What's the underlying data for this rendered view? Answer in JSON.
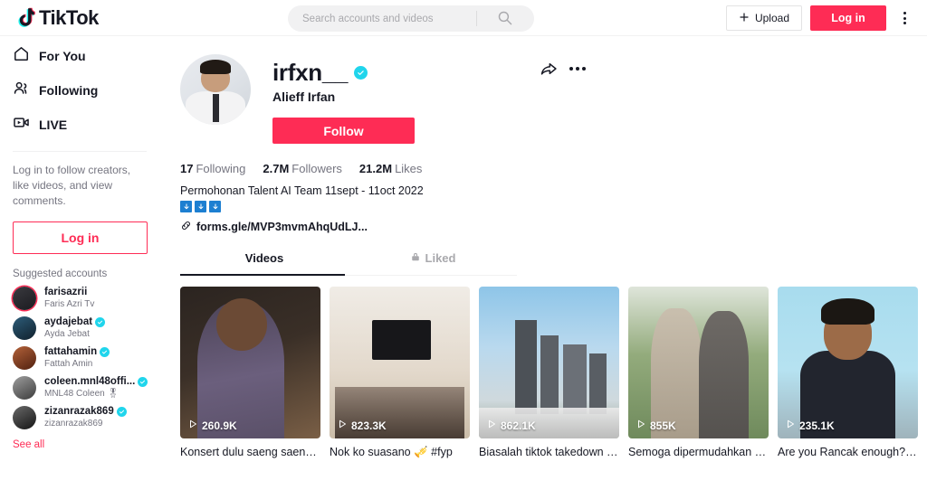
{
  "header": {
    "brand": "TikTok",
    "search": {
      "placeholder": "Search accounts and videos",
      "value": "",
      "icon": "search-icon"
    },
    "upload_label": "Upload",
    "login_label": "Log in",
    "more_icon": "kebab-vertical-icon"
  },
  "sidebar": {
    "nav": [
      {
        "label": "For You",
        "icon": "home-icon"
      },
      {
        "label": "Following",
        "icon": "people-icon"
      },
      {
        "label": "LIVE",
        "icon": "video-camera-icon"
      }
    ],
    "login_prompt": "Log in to follow creators, like videos, and view comments.",
    "login_label": "Log in",
    "suggested_heading": "Suggested accounts",
    "suggested": [
      {
        "username": "farisazrii",
        "name": "Faris Azri Tv",
        "verified": false,
        "live_ring": true
      },
      {
        "username": "aydajebat",
        "name": "Ayda Jebat",
        "verified": true,
        "live_ring": false
      },
      {
        "username": "fattahamin",
        "name": "Fattah Amin",
        "verified": true,
        "live_ring": false
      },
      {
        "username": "coleen.mnl48offi...",
        "name": "MNL48 Coleen 🎖",
        "verified": true,
        "live_ring": false
      },
      {
        "username": "zizanrazak869",
        "name": "zizanrazak869",
        "verified": true,
        "live_ring": false
      }
    ],
    "see_all": "See all"
  },
  "profile": {
    "username": "irfxn__",
    "display_name": "Alieff Irfan",
    "verified": true,
    "follow_label": "Follow",
    "share_icon": "share-arrow-icon",
    "more_icon": "kebab-horizontal-icon",
    "stats": [
      {
        "value": "17",
        "label": "Following"
      },
      {
        "value": "2.7M",
        "label": "Followers"
      },
      {
        "value": "21.2M",
        "label": "Likes"
      }
    ],
    "bio": "Permohonan Talent AI Team 11sept - 11oct 2022",
    "bio_emojis": [
      "arrow-down-emoji",
      "arrow-down-emoji",
      "arrow-down-emoji"
    ],
    "link": "forms.gle/MVP3mvmAhqUdLJ...",
    "link_icon": "chain-link-icon"
  },
  "tabs": [
    {
      "label": "Videos",
      "active": true
    },
    {
      "label": "Liked",
      "active": false,
      "icon": "lock-icon"
    }
  ],
  "videos": [
    {
      "views": "260.9K",
      "caption": "Konsert dulu saeng saeng…",
      "thumb": "t1"
    },
    {
      "views": "823.3K",
      "caption": "Nok ko suasano 🎺 #fyp",
      "thumb": "t2"
    },
    {
      "views": "862.1K",
      "caption": "Biasalah tiktok takedown …",
      "thumb": "t3"
    },
    {
      "views": "855K",
      "caption": "Semoga dipermudahkan …",
      "thumb": "t4"
    },
    {
      "views": "235.1K",
      "caption": "Are you Rancak enough?!…",
      "thumb": "t5"
    }
  ],
  "colors": {
    "accent": "#fe2c55",
    "verified": "#20d5ec",
    "text": "#161823",
    "muted": "#757580"
  }
}
